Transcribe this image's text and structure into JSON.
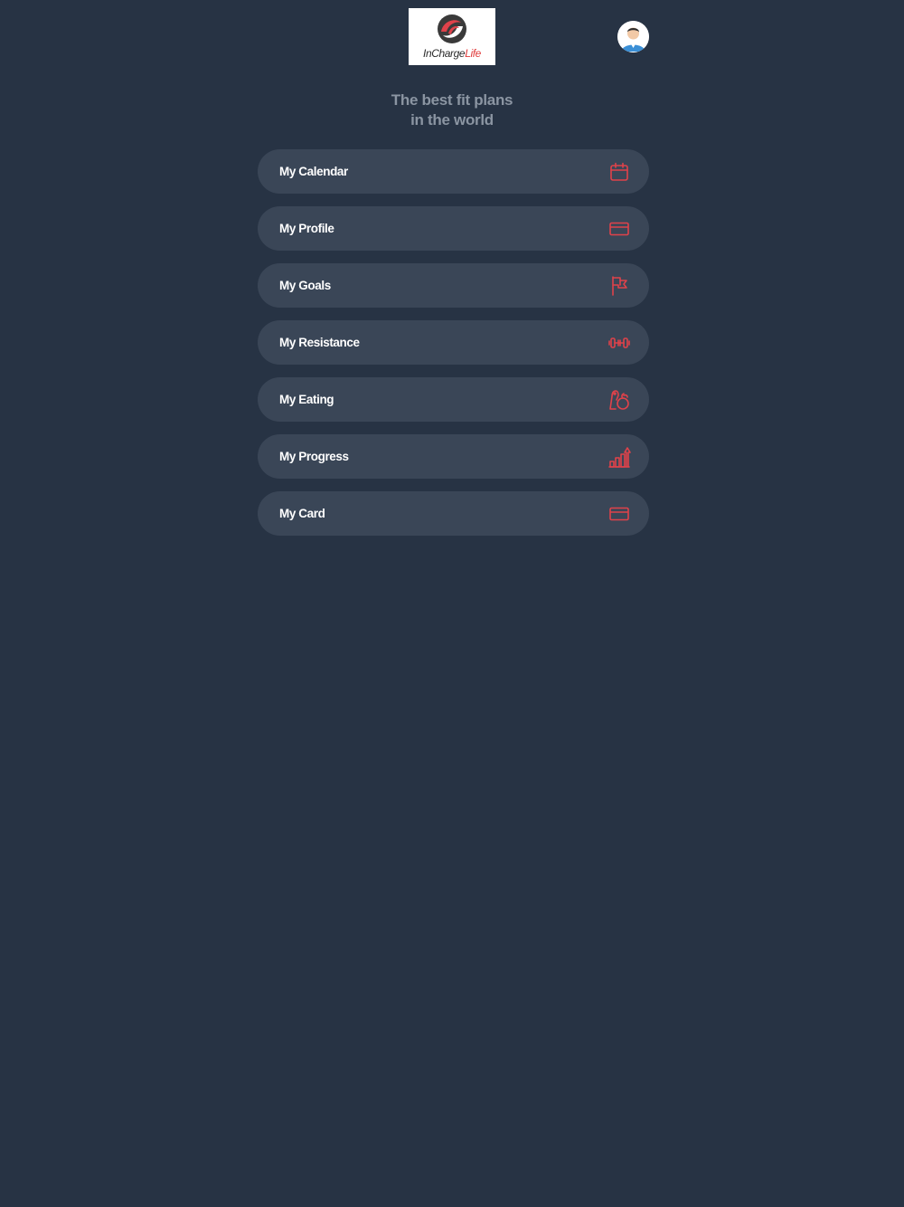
{
  "header": {
    "logo": {
      "text_part1": "InCharge",
      "text_part2": "Life",
      "icon": "incharge-life-logo"
    },
    "avatar_icon": "user-avatar-icon"
  },
  "tagline": {
    "line1": "The best fit plans",
    "line2": "in the world"
  },
  "menu": {
    "items": [
      {
        "label": "My Calendar",
        "icon": "calendar-icon"
      },
      {
        "label": "My Profile",
        "icon": "id-card-icon"
      },
      {
        "label": "My Goals",
        "icon": "flag-icon"
      },
      {
        "label": "My Resistance",
        "icon": "dumbbell-icon"
      },
      {
        "label": "My Eating",
        "icon": "food-icon"
      },
      {
        "label": "My Progress",
        "icon": "progress-chart-icon"
      },
      {
        "label": "My Card",
        "icon": "credit-card-icon"
      }
    ]
  },
  "colors": {
    "background": "#273344",
    "menu_item": "#3a4657",
    "accent": "#e0424a",
    "tagline": "#8b95a2",
    "label": "#ffffff"
  }
}
